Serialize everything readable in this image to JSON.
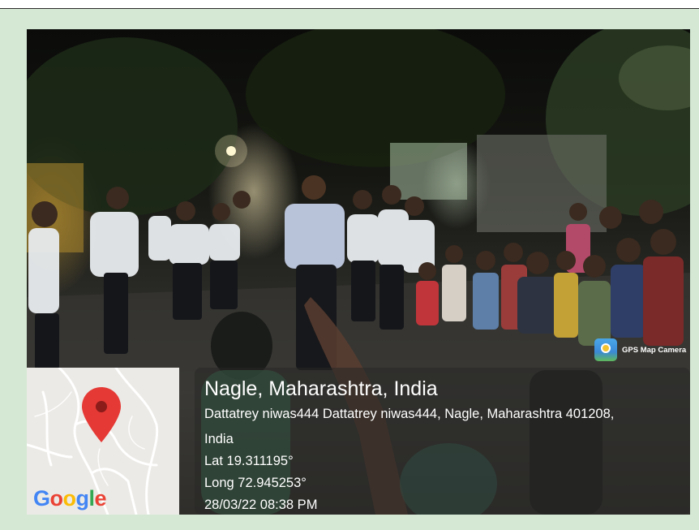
{
  "photo": {
    "subject": "night gathering of volunteers in white shirts with children on a street"
  },
  "map": {
    "pin_color": "#e53935",
    "logo_text": "Google"
  },
  "badge": {
    "label": "GPS Map Camera",
    "icon": "gps-map-camera-icon"
  },
  "location": {
    "title": "Nagle, Maharashtra, India",
    "address_line1": "Dattatrey niwas444 Dattatrey niwas444, Nagle, Maharashtra 401208,",
    "address_line2": "India",
    "latitude": "Lat 19.311195°",
    "longitude": "Long 72.945253°",
    "timestamp": "28/03/22 08:38 PM"
  },
  "colors": {
    "frame": "#d4e8d4",
    "panel": "#28282680"
  }
}
